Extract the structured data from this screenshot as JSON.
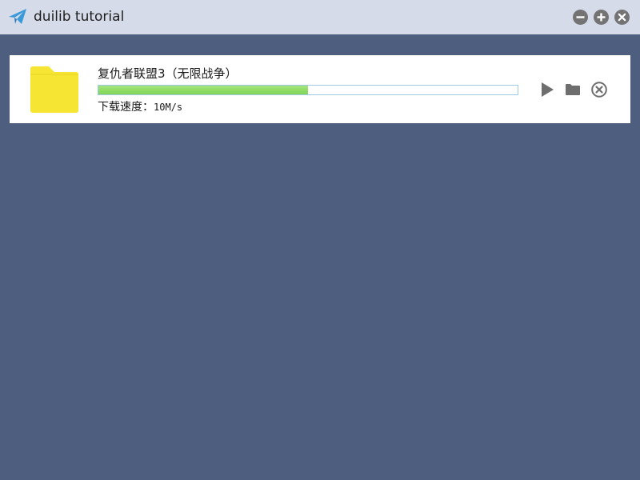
{
  "window": {
    "title": "duilib tutorial",
    "icon": "paper-plane-icon",
    "controls": [
      "minimize-icon",
      "maximize-icon",
      "close-icon"
    ]
  },
  "colors": {
    "titlebar": "#d6dbe9",
    "background": "#4e5e7e",
    "accent": "#3a9ad9",
    "progress": "#8fdc66",
    "folder": "#f7e533",
    "button_gray": "#6e6e6e"
  },
  "download": {
    "file_icon": "folder-icon",
    "name": "复仇者联盟3（无限战争）",
    "progress_percent": 50,
    "speed_label": "下载速度：",
    "speed_value": "10M/s",
    "actions": [
      "play-icon",
      "open-folder-icon",
      "cancel-icon"
    ]
  }
}
